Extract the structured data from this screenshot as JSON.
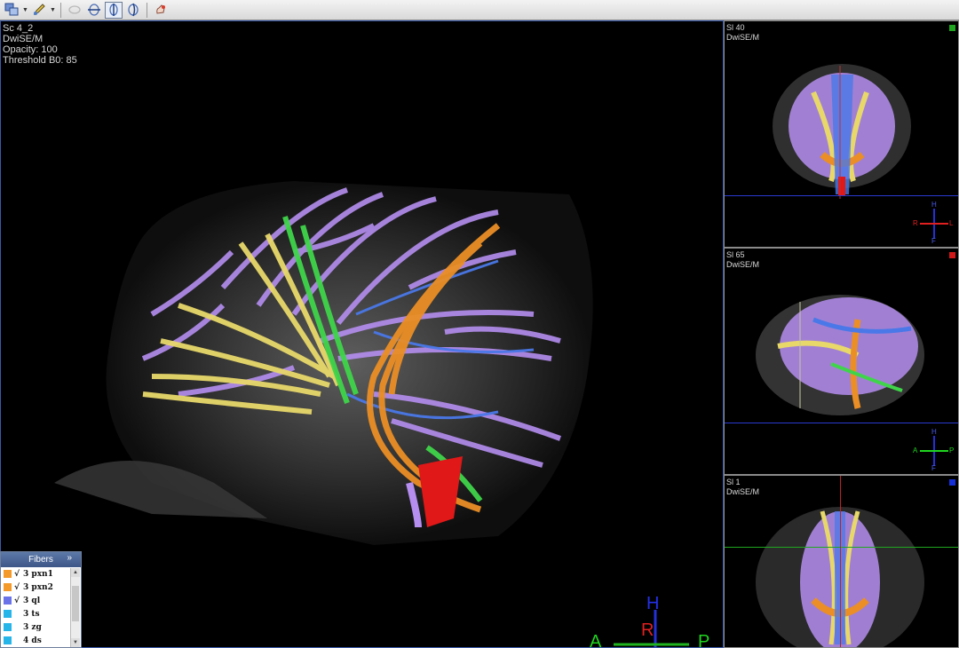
{
  "main_view": {
    "info": [
      "Sc 4_2",
      "DwiSE/M",
      "Opacity: 100",
      "Threshold B0: 85"
    ],
    "orientation": {
      "h": "H",
      "r": "R",
      "a": "A",
      "p": "P"
    }
  },
  "side_views": [
    {
      "slice": "Sl 40",
      "series": "DwiSE/M",
      "marker_color": "#1fa51f",
      "orientation": {
        "h": "H",
        "r": "R",
        "l": "L",
        "f": "F"
      }
    },
    {
      "slice": "Sl 65",
      "series": "DwiSE/M",
      "marker_color": "#d01818",
      "orientation": {
        "h": "H",
        "a": "A",
        "p": "P",
        "f": "F"
      }
    },
    {
      "slice": "Sl 1",
      "series": "DwiSE/M",
      "marker_color": "#1530d8"
    }
  ],
  "fibers_panel": {
    "title": "Fibers",
    "expand": "»",
    "items": [
      {
        "label": "3 pxn1",
        "checked": "√",
        "color": "#f39a2a"
      },
      {
        "label": "3 pxn2",
        "checked": "√",
        "color": "#f39a2a"
      },
      {
        "label": "3 ql",
        "checked": "√",
        "color": "#6a73e8"
      },
      {
        "label": "3 ts",
        "checked": "",
        "color": "#26b5e8"
      },
      {
        "label": "3 zg",
        "checked": "",
        "color": "#26b5e8"
      },
      {
        "label": "4 ds",
        "checked": "",
        "color": "#26b5e8"
      }
    ]
  }
}
